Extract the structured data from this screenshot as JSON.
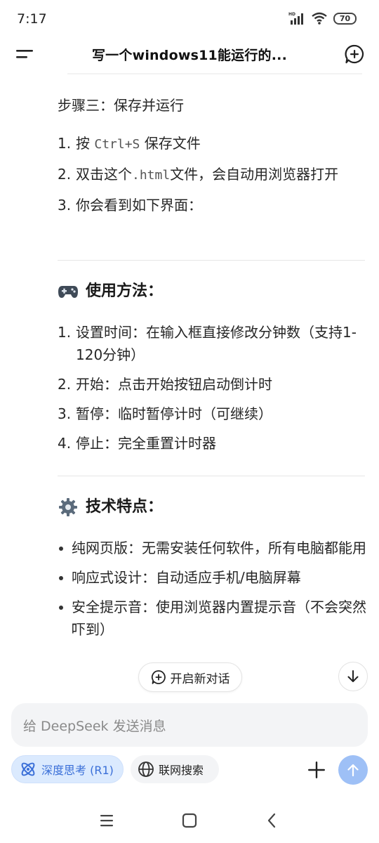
{
  "status": {
    "time": "7:17",
    "network": "HD",
    "battery": "70"
  },
  "header": {
    "title": "写一个windows11能运行的..."
  },
  "step3": {
    "title": "步骤三：保存并运行",
    "items": [
      {
        "num": "1.",
        "pre": "按 ",
        "code": "Ctrl+S",
        "post": " 保存文件"
      },
      {
        "num": "2.",
        "pre": "双击这个",
        "code": ".html",
        "post": "文件，会自动用浏览器打开"
      },
      {
        "num": "3.",
        "pre": "你会看到如下界面：",
        "code": "",
        "post": ""
      }
    ]
  },
  "usage": {
    "title": "使用方法：",
    "icon": "gamepad-icon",
    "items": [
      {
        "num": "1.",
        "text": "设置时间：在输入框直接修改分钟数（支持1-120分钟）"
      },
      {
        "num": "2.",
        "text": "开始：点击开始按钮启动倒计时"
      },
      {
        "num": "3.",
        "text": "暂停：临时暂停计时（可继续）"
      },
      {
        "num": "4.",
        "text": "停止：完全重置计时器"
      }
    ]
  },
  "features": {
    "title": "技术特点：",
    "icon": "gear-icon",
    "items": [
      {
        "text": "纯网页版：无需安装任何软件，所有电脑都能用"
      },
      {
        "text": "响应式设计：自动适应手机/电脑屏幕"
      },
      {
        "text": "安全提示音：使用浏览器内置提示音（不会突然吓到）"
      }
    ]
  },
  "floating": {
    "new_chat_label": "开启新对话"
  },
  "composer": {
    "placeholder": "给 DeepSeek 发送消息",
    "deep_think_label": "深度思考 (R1)",
    "web_search_label": "联网搜索"
  },
  "colors": {
    "accent": "#3a6fd8",
    "chip_bg": "#dbeafe",
    "send_bg": "#9ec0f6"
  }
}
